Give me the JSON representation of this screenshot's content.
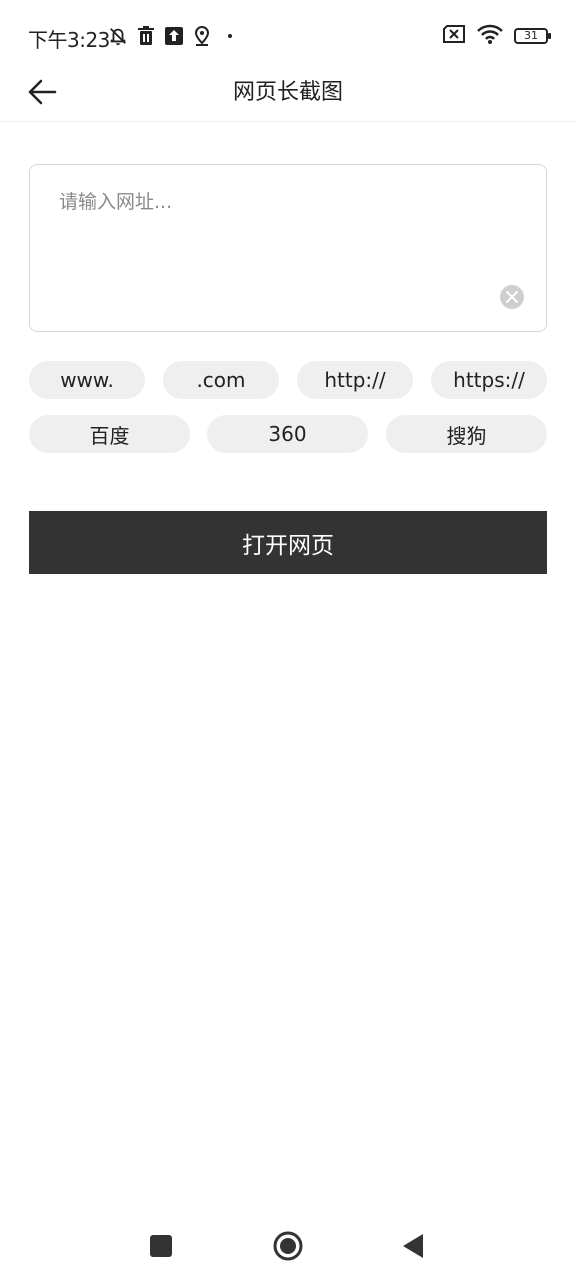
{
  "status_bar": {
    "time": "下午3:23",
    "battery": "31",
    "left_icons": [
      "vibrate-off-icon",
      "trash-icon",
      "upload-icon",
      "location-icon",
      "dot-icon"
    ],
    "right_icons": [
      "sim-off-icon",
      "wifi-icon",
      "battery-icon"
    ]
  },
  "app_bar": {
    "title": "网页长截图",
    "back_icon": "arrow-left-icon"
  },
  "url_input": {
    "placeholder": "请输入网址...",
    "value": ""
  },
  "chips": {
    "row1": [
      "www.",
      ".com",
      "http://",
      "https://"
    ],
    "row2": [
      "百度",
      "360",
      "搜狗"
    ]
  },
  "open_button": {
    "label": "打开网页"
  },
  "colors": {
    "button_bg": "#333333",
    "chip_bg": "#efefef",
    "border": "#d6d6d6"
  },
  "nav_bar": {
    "items": [
      "recents-square-icon",
      "home-circle-icon",
      "back-triangle-icon"
    ]
  }
}
